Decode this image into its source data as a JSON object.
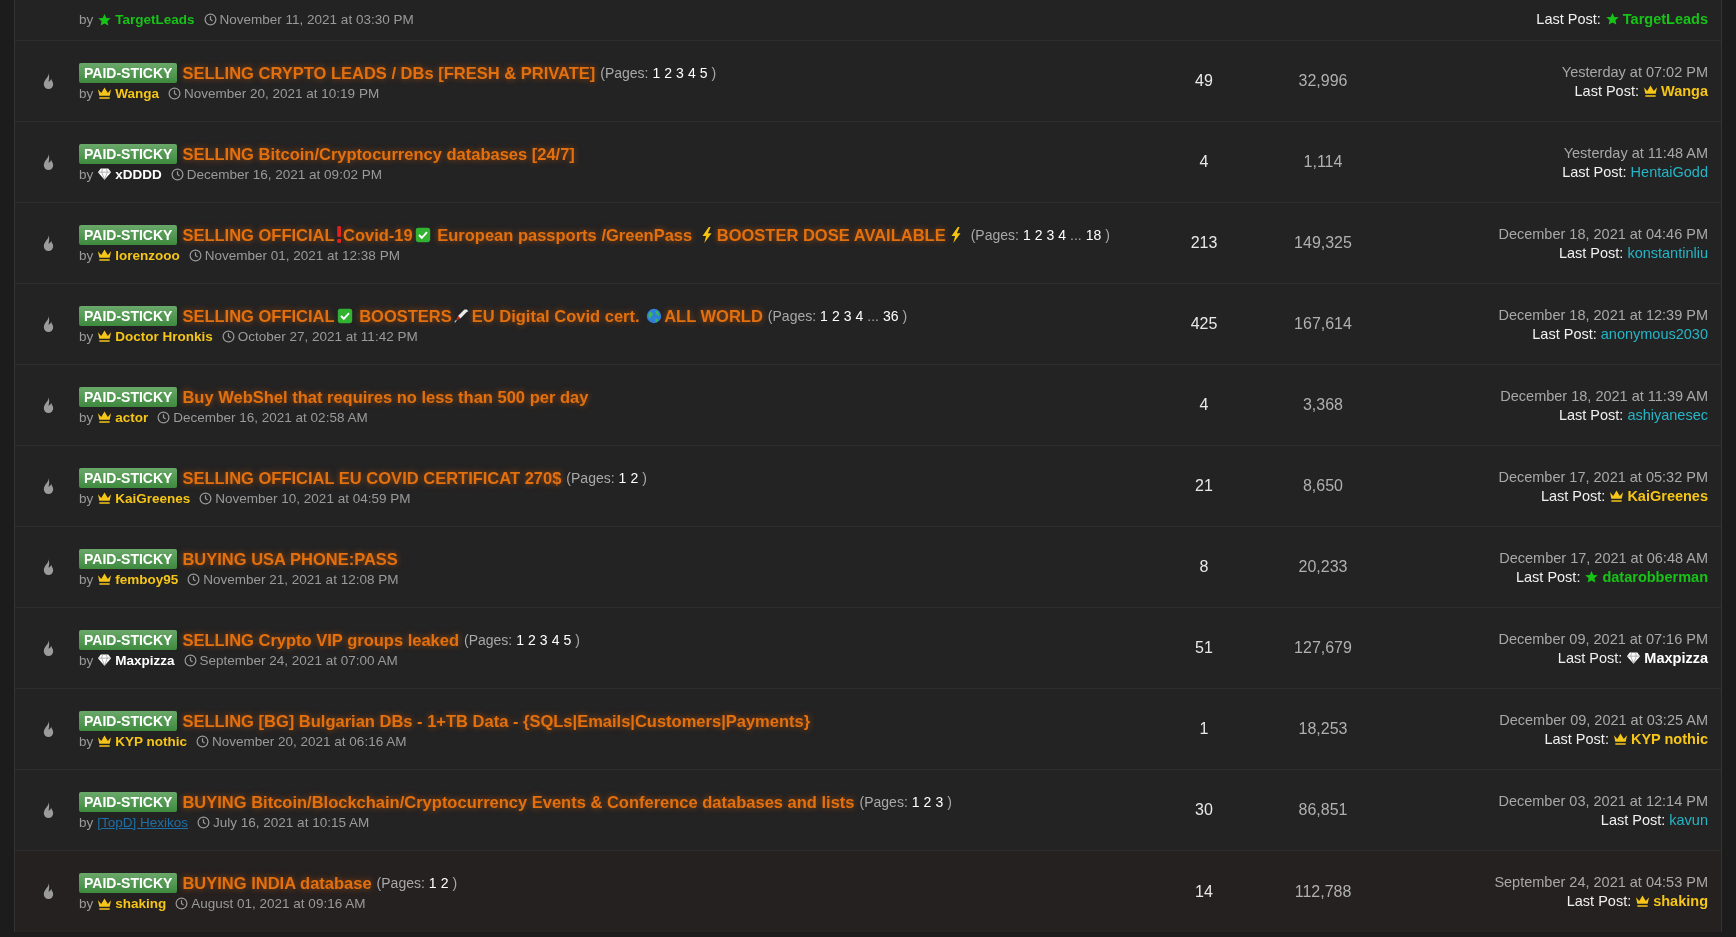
{
  "cut_row": {
    "by_label": "by",
    "author": {
      "name": "TargetLeads",
      "kind": "star"
    },
    "date": "November 11, 2021 at 03:30 PM",
    "last_post": {
      "label": "Last Post:",
      "user": {
        "name": "TargetLeads",
        "kind": "star"
      }
    }
  },
  "threads": [
    {
      "badge": "PAID-STICKY",
      "title": [
        {
          "kind": "text",
          "text": "SELLING CRYPTO LEADS / DBs [FRESH & PRIVATE]"
        }
      ],
      "pages": {
        "prefix": "(Pages:",
        "items": [
          {
            "kind": "link",
            "text": "1"
          },
          {
            "kind": "link",
            "text": "2"
          },
          {
            "kind": "link",
            "text": "3"
          },
          {
            "kind": "link",
            "text": "4"
          },
          {
            "kind": "link",
            "text": "5"
          }
        ],
        "suffix": ")"
      },
      "by_label": "by",
      "author": {
        "name": "Wanga",
        "kind": "crown"
      },
      "date": "November 20, 2021 at 10:19 PM",
      "replies": "49",
      "views": "32,996",
      "last_post": {
        "date": "Yesterday at 07:02 PM",
        "label": "Last Post:",
        "user": {
          "name": "Wanga",
          "kind": "crown"
        }
      }
    },
    {
      "badge": "PAID-STICKY",
      "title": [
        {
          "kind": "text",
          "text": "SELLING Bitcoin/Cryptocurrency databases [24/7]"
        }
      ],
      "by_label": "by",
      "author": {
        "name": "xDDDD",
        "kind": "diamond"
      },
      "date": "December 16, 2021 at 09:02 PM",
      "replies": "4",
      "views": "1,114",
      "last_post": {
        "date": "Yesterday at 11:48 AM",
        "label": "Last Post:",
        "user": {
          "name": "HentaiGodd",
          "kind": "plain"
        }
      }
    },
    {
      "badge": "PAID-STICKY",
      "title": [
        {
          "kind": "text",
          "text": "SELLING OFFICIAL"
        },
        {
          "kind": "exclamation"
        },
        {
          "kind": "text",
          "text": "Covid-19"
        },
        {
          "kind": "check"
        },
        {
          "kind": "text",
          "text": " European passports /GreenPass "
        },
        {
          "kind": "bolt"
        },
        {
          "kind": "text",
          "text": "BOOSTER DOSE AVAILABLE"
        },
        {
          "kind": "bolt"
        }
      ],
      "pages": {
        "prefix": "(Pages:",
        "items": [
          {
            "kind": "link",
            "text": "1"
          },
          {
            "kind": "link",
            "text": "2"
          },
          {
            "kind": "link",
            "text": "3"
          },
          {
            "kind": "link",
            "text": "4"
          },
          {
            "kind": "gap",
            "text": "..."
          },
          {
            "kind": "link",
            "text": "18"
          }
        ],
        "suffix": ")"
      },
      "by_label": "by",
      "author": {
        "name": "lorenzooo",
        "kind": "crown"
      },
      "date": "November 01, 2021 at 12:38 PM",
      "replies": "213",
      "views": "149,325",
      "last_post": {
        "date": "December 18, 2021 at 04:46 PM",
        "label": "Last Post:",
        "user": {
          "name": "konstantinliu",
          "kind": "plain"
        }
      }
    },
    {
      "badge": "PAID-STICKY",
      "title": [
        {
          "kind": "text",
          "text": "SELLING OFFICIAL"
        },
        {
          "kind": "check"
        },
        {
          "kind": "text",
          "text": " BOOSTERS"
        },
        {
          "kind": "syringe"
        },
        {
          "kind": "text",
          "text": "EU Digital Covid cert. "
        },
        {
          "kind": "globe"
        },
        {
          "kind": "text",
          "text": "ALL WORLD"
        }
      ],
      "pages": {
        "prefix": "(Pages:",
        "items": [
          {
            "kind": "link",
            "text": "1"
          },
          {
            "kind": "link",
            "text": "2"
          },
          {
            "kind": "link",
            "text": "3"
          },
          {
            "kind": "link",
            "text": "4"
          },
          {
            "kind": "gap",
            "text": "..."
          },
          {
            "kind": "link",
            "text": "36"
          }
        ],
        "suffix": ")"
      },
      "by_label": "by",
      "author": {
        "name": "Doctor Hronkis",
        "kind": "crown"
      },
      "date": "October 27, 2021 at 11:42 PM",
      "replies": "425",
      "views": "167,614",
      "last_post": {
        "date": "December 18, 2021 at 12:39 PM",
        "label": "Last Post:",
        "user": {
          "name": "anonymous2030",
          "kind": "plain"
        }
      }
    },
    {
      "badge": "PAID-STICKY",
      "title": [
        {
          "kind": "text",
          "text": "Buy WebShel that requires no less than 500 per day"
        }
      ],
      "by_label": "by",
      "author": {
        "name": "actor",
        "kind": "crown"
      },
      "date": "December 16, 2021 at 02:58 AM",
      "replies": "4",
      "views": "3,368",
      "last_post": {
        "date": "December 18, 2021 at 11:39 AM",
        "label": "Last Post:",
        "user": {
          "name": "ashiyanesec",
          "kind": "plain"
        }
      }
    },
    {
      "badge": "PAID-STICKY",
      "title": [
        {
          "kind": "text",
          "text": "SELLING OFFICIAL EU COVID CERTIFICAT 270$"
        }
      ],
      "pages": {
        "prefix": "(Pages:",
        "items": [
          {
            "kind": "link",
            "text": "1"
          },
          {
            "kind": "link",
            "text": "2"
          }
        ],
        "suffix": ")"
      },
      "by_label": "by",
      "author": {
        "name": "KaiGreenes",
        "kind": "crown"
      },
      "date": "November 10, 2021 at 04:59 PM",
      "replies": "21",
      "views": "8,650",
      "last_post": {
        "date": "December 17, 2021 at 05:32 PM",
        "label": "Last Post:",
        "user": {
          "name": "KaiGreenes",
          "kind": "crown"
        }
      }
    },
    {
      "badge": "PAID-STICKY",
      "title": [
        {
          "kind": "text",
          "text": "BUYING USA PHONE:PASS"
        }
      ],
      "by_label": "by",
      "author": {
        "name": "femboy95",
        "kind": "crown"
      },
      "date": "November 21, 2021 at 12:08 PM",
      "replies": "8",
      "views": "20,233",
      "last_post": {
        "date": "December 17, 2021 at 06:48 AM",
        "label": "Last Post:",
        "user": {
          "name": "datarobberman",
          "kind": "star"
        }
      }
    },
    {
      "badge": "PAID-STICKY",
      "title": [
        {
          "kind": "text",
          "text": "SELLING Crypto VIP groups leaked"
        }
      ],
      "pages": {
        "prefix": "(Pages:",
        "items": [
          {
            "kind": "link",
            "text": "1"
          },
          {
            "kind": "link",
            "text": "2"
          },
          {
            "kind": "link",
            "text": "3"
          },
          {
            "kind": "link",
            "text": "4"
          },
          {
            "kind": "link",
            "text": "5"
          }
        ],
        "suffix": ")"
      },
      "by_label": "by",
      "author": {
        "name": "Maxpizza",
        "kind": "diamond"
      },
      "date": "September 24, 2021 at 07:00 AM",
      "replies": "51",
      "views": "127,679",
      "last_post": {
        "date": "December 09, 2021 at 07:16 PM",
        "label": "Last Post:",
        "user": {
          "name": "Maxpizza",
          "kind": "diamond"
        }
      }
    },
    {
      "badge": "PAID-STICKY",
      "title": [
        {
          "kind": "text",
          "text": "SELLING [BG] Bulgarian DBs - 1+TB Data - {SQLs|Emails|Customers|Payments}"
        }
      ],
      "by_label": "by",
      "author": {
        "name": "KYP nothic",
        "kind": "crown"
      },
      "date": "November 20, 2021 at 06:16 AM",
      "replies": "1",
      "views": "18,253",
      "last_post": {
        "date": "December 09, 2021 at 03:25 AM",
        "label": "Last Post:",
        "user": {
          "name": "KYP nothic",
          "kind": "crown"
        }
      }
    },
    {
      "badge": "PAID-STICKY",
      "title": [
        {
          "kind": "text",
          "text": "BUYING Bitcoin/Blockchain/Cryptocurrency Events & Conference databases and lists"
        }
      ],
      "pages": {
        "prefix": "(Pages:",
        "items": [
          {
            "kind": "link",
            "text": "1"
          },
          {
            "kind": "link",
            "text": "2"
          },
          {
            "kind": "link",
            "text": "3"
          }
        ],
        "suffix": ")"
      },
      "by_label": "by",
      "author": {
        "name": "[TopD] Hexikos",
        "kind": "staff"
      },
      "date": "July 16, 2021 at 10:15 AM",
      "replies": "30",
      "views": "86,851",
      "last_post": {
        "date": "December 03, 2021 at 12:14 PM",
        "label": "Last Post:",
        "user": {
          "name": "kavun",
          "kind": "plain"
        }
      }
    },
    {
      "badge": "PAID-STICKY",
      "title": [
        {
          "kind": "text",
          "text": "BUYING INDIA database"
        }
      ],
      "pages": {
        "prefix": "(Pages:",
        "items": [
          {
            "kind": "link",
            "text": "1"
          },
          {
            "kind": "link",
            "text": "2"
          }
        ],
        "suffix": ")"
      },
      "by_label": "by",
      "author": {
        "name": "shaking",
        "kind": "crown"
      },
      "date": "August 01, 2021 at 09:16 AM",
      "replies": "14",
      "views": "112,788",
      "last_post": {
        "date": "September 24, 2021 at 04:53 PM",
        "label": "Last Post:",
        "user": {
          "name": "shaking",
          "kind": "crown"
        }
      }
    }
  ]
}
